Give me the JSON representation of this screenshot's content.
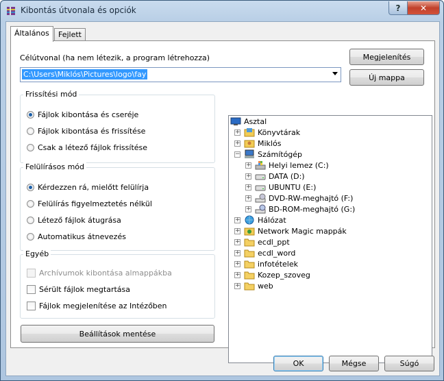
{
  "window": {
    "title": "Kibontás útvonala és opciók",
    "help_glyph": "?",
    "close_glyph": "✕"
  },
  "tabs": [
    {
      "label": "Általános"
    },
    {
      "label": "Fejlett"
    }
  ],
  "destination": {
    "label": "Célútvonal (ha nem létezik, a program létrehozza)",
    "value": "C:\\Users\\Miklós\\Pictures\\logo\\fay"
  },
  "buttons": {
    "show": "Megjelenítés",
    "new_folder": "Új mappa",
    "save_settings": "Beállítások mentése",
    "ok": "OK",
    "cancel": "Mégse",
    "help": "Súgó"
  },
  "update_mode": {
    "title": "Frissítési mód",
    "options": [
      "Fájlok kibontása és cseréje",
      "Fájlok kibontása és frissítése",
      "Csak a létező fájlok frissítése"
    ],
    "selected": 0
  },
  "overwrite_mode": {
    "title": "Felülírásos mód",
    "options": [
      "Kérdezzen rá, mielőtt felülírja",
      "Felülírás figyelmeztetés nélkül",
      "Létező fájlok átugrása",
      "Automatikus átnevezés"
    ],
    "selected": 0
  },
  "misc": {
    "title": "Egyéb",
    "options": [
      {
        "label": "Archívumok kibontása almappákba",
        "checked": false,
        "disabled": true
      },
      {
        "label": "Sérült fájlok megtartása",
        "checked": false,
        "disabled": false
      },
      {
        "label": "Fájlok megjelenítése az Intézőben",
        "checked": false,
        "disabled": false
      }
    ]
  },
  "tree": [
    {
      "label": "Asztal",
      "icon": "desktop-icon",
      "level": 0,
      "toggle": ""
    },
    {
      "label": "Könyvtárak",
      "icon": "libraries-icon",
      "level": 1,
      "toggle": "+"
    },
    {
      "label": "Miklós",
      "icon": "user-folder-icon",
      "level": 1,
      "toggle": "+"
    },
    {
      "label": "Számítógép",
      "icon": "computer-icon",
      "level": 1,
      "toggle": "−"
    },
    {
      "label": "Helyi lemez (C:)",
      "icon": "system-drive-icon",
      "level": 2,
      "toggle": "+"
    },
    {
      "label": "DATA (D:)",
      "icon": "drive-icon",
      "level": 2,
      "toggle": "+"
    },
    {
      "label": "UBUNTU (E:)",
      "icon": "drive-icon",
      "level": 2,
      "toggle": "+"
    },
    {
      "label": "DVD-RW-meghajtó (F:)",
      "icon": "dvd-drive-icon",
      "level": 2,
      "toggle": "+"
    },
    {
      "label": "BD-ROM-meghajtó (G:)",
      "icon": "bd-drive-icon",
      "level": 2,
      "toggle": "+"
    },
    {
      "label": "Hálózat",
      "icon": "network-icon",
      "level": 1,
      "toggle": "+"
    },
    {
      "label": "Network Magic mappák",
      "icon": "network-magic-icon",
      "level": 1,
      "toggle": "+"
    },
    {
      "label": "ecdl_ppt",
      "icon": "folder-icon",
      "level": 1,
      "toggle": "+"
    },
    {
      "label": "ecdl_word",
      "icon": "folder-icon",
      "level": 1,
      "toggle": "+"
    },
    {
      "label": "infotételek",
      "icon": "folder-icon",
      "level": 1,
      "toggle": "+"
    },
    {
      "label": "Kozep_szoveg",
      "icon": "folder-icon",
      "level": 1,
      "toggle": "+"
    },
    {
      "label": "web",
      "icon": "folder-icon",
      "level": 1,
      "toggle": "+"
    }
  ],
  "colors": {
    "selection": "#3399ff",
    "title_bar": "#b9cfe6",
    "close_button": "#c1412b"
  }
}
